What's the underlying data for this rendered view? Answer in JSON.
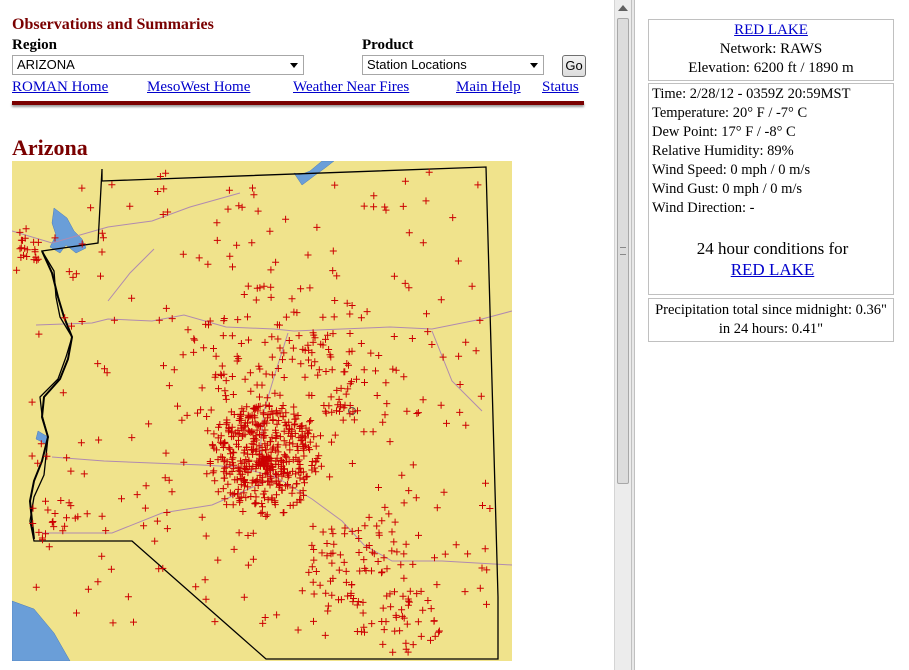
{
  "header": {
    "title": "Observations and Summaries"
  },
  "region": {
    "label": "Region",
    "selected": "ARIZONA"
  },
  "product": {
    "label": "Product",
    "selected": "Station Locations"
  },
  "go_button": "Go",
  "nav": [
    "ROMAN Home",
    "MesoWest Home",
    "Weather Near Fires",
    "Main Help",
    "Status"
  ],
  "state_title": "Arizona",
  "map": {
    "land_color": "#f0e38c",
    "water_color": "#6a9ed8",
    "marker_color": "#cc0000"
  },
  "station": {
    "name": "RED LAKE",
    "network": "Network: RAWS",
    "elevation": "Elevation: 6200 ft / 1890 m",
    "time": "Time: 2/28/12 - 0359Z 20:59MST",
    "temperature": "Temperature: 20° F / -7° C",
    "dew_point": "Dew Point: 17° F / -8° C",
    "relative_humidity": "Relative Humidity: 89%",
    "wind_speed": "Wind Speed: 0 mph / 0 m/s",
    "wind_gust": "Wind Gust: 0 mph / 0 m/s",
    "wind_direction": "Wind Direction: -",
    "conditions_heading": "24 hour conditions for",
    "conditions_link": "RED LAKE",
    "precip_midnight": "Precipitation total since midnight: 0.36\"",
    "precip_24h": "in 24 hours: 0.41\""
  }
}
